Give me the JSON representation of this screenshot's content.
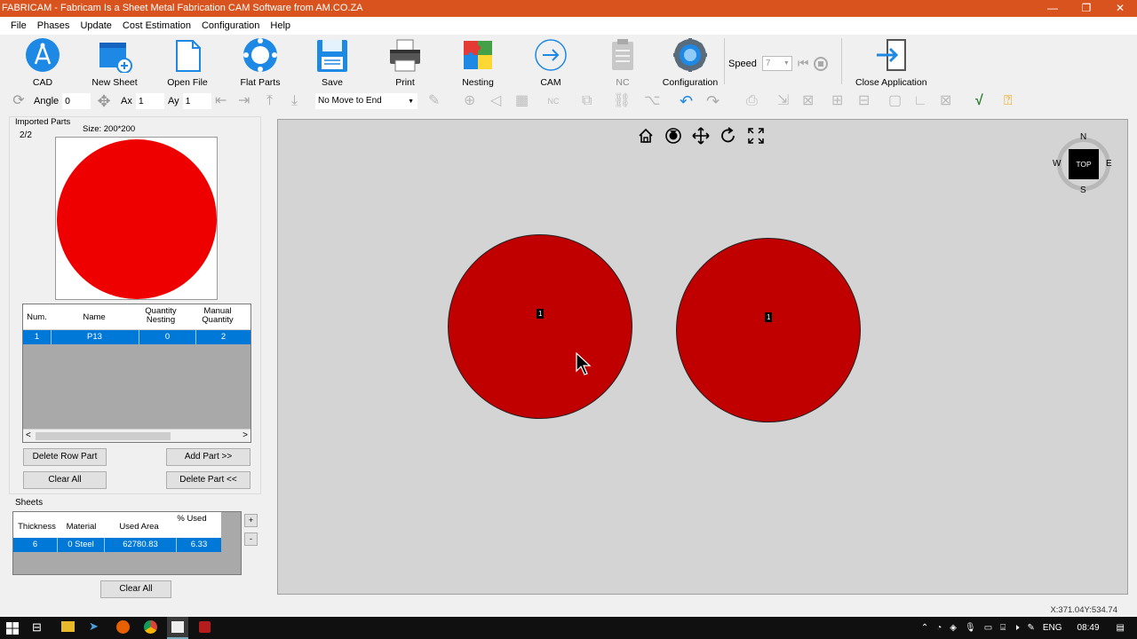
{
  "window": {
    "title": "FABRICAM - Fabricam Is a Sheet Metal Fabrication CAM Software from AM.CO.ZA",
    "minimize": "—",
    "restore": "❐",
    "close": "✕"
  },
  "menu": [
    "File",
    "Phases",
    "Update",
    "Cost Estimation",
    "Configuration",
    "Help"
  ],
  "toolbar": {
    "cad": "CAD",
    "new_sheet": "New Sheet",
    "open_file": "Open File",
    "flat_parts": "Flat Parts",
    "save": "Save",
    "print": "Print",
    "nesting": "Nesting",
    "cam": "CAM",
    "nc": "NC",
    "configuration": "Configuration",
    "speed_label": "Speed",
    "speed_value": "7",
    "close_application": "Close Application"
  },
  "toolbar2": {
    "angle_label": "Angle",
    "angle_value": "0",
    "ax_label": "Ax",
    "ax_value": "1",
    "ay_label": "Ay",
    "ay_value": "1",
    "move_select": "No Move to End"
  },
  "imported_parts": {
    "title": "Imported Parts",
    "counter": "2/2",
    "size": "Size: 200*200",
    "preview_color": "#ee0000",
    "headers": [
      "Num.",
      "Name",
      "Quantity Nesting",
      "Manual Quantity"
    ],
    "rows": [
      {
        "num": "1",
        "name": "P13",
        "qty_nesting": "0",
        "manual_qty": "2"
      }
    ],
    "hscroll_left": "<",
    "hscroll_right": ">"
  },
  "buttons": {
    "delete_row_part": "Delete Row Part",
    "add_part": "Add Part >>",
    "clear_all": "Clear All",
    "delete_part": "Delete Part <<",
    "sheets_clear_all": "Clear All",
    "sheet_plus": "+",
    "sheet_minus": "-"
  },
  "sheets": {
    "title": "Sheets",
    "headers": [
      "Thickness",
      "Material",
      "Used Area",
      "% Used"
    ],
    "rows": [
      {
        "thickness": "6",
        "material": "0  Steel",
        "used_area": "62780.83",
        "used_pct": "6.33"
      }
    ]
  },
  "viewport": {
    "part_color": "#c00000",
    "part_labels": [
      "1",
      "1"
    ],
    "compass": {
      "n": "N",
      "s": "S",
      "e": "E",
      "w": "W",
      "center": "TOP"
    }
  },
  "status": {
    "coords": "X:371.04Y:534.74"
  },
  "taskbar": {
    "lang": "ENG",
    "time": "08:49"
  },
  "colors": {
    "titlebar": "#d9531e",
    "selection": "#0078d7",
    "canvas": "#d4d4d4"
  }
}
